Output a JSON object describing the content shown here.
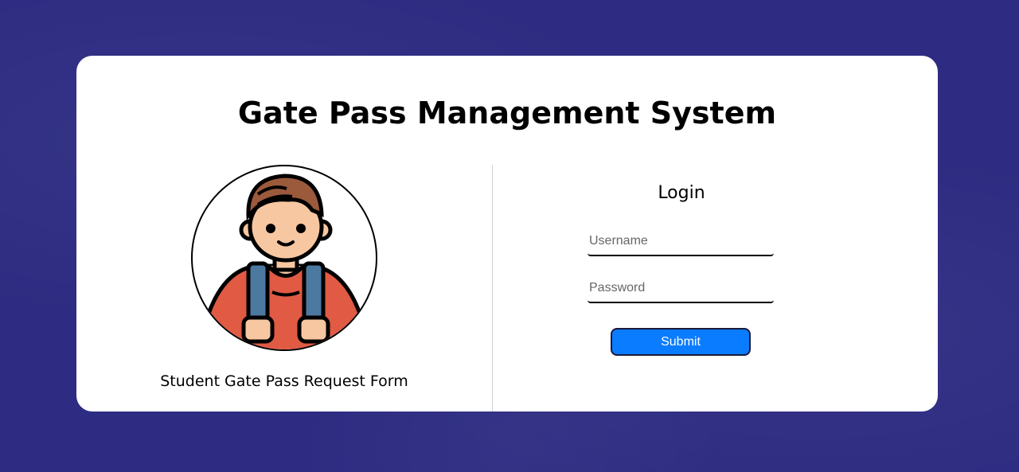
{
  "page": {
    "title": "Gate Pass Management System"
  },
  "left_panel": {
    "caption": "Student Gate Pass Request Form",
    "image": "student-avatar-icon"
  },
  "login": {
    "heading": "Login",
    "username_placeholder": "Username",
    "username_value": "",
    "password_placeholder": "Password",
    "password_value": "",
    "submit_label": "Submit"
  },
  "colors": {
    "background": "#2d2c82",
    "card": "#ffffff",
    "submit_button": "#0a7cff"
  }
}
